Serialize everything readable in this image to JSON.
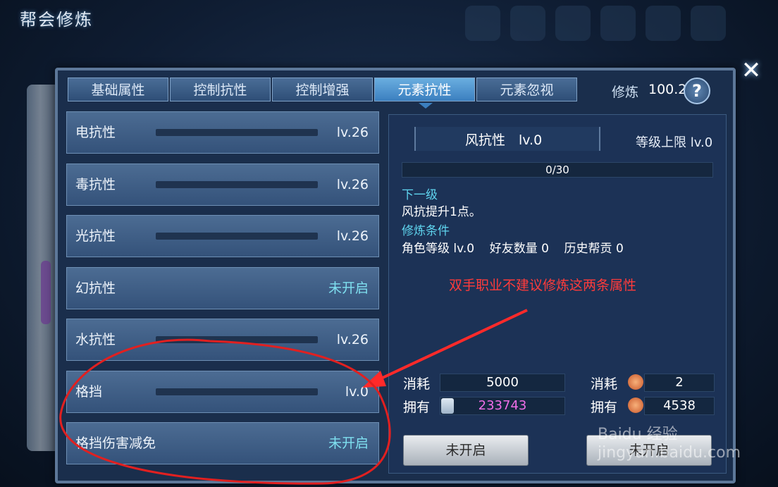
{
  "title": "帮会修炼",
  "close_icon": "close-icon",
  "tabs": [
    {
      "label": "基础属性",
      "active": false
    },
    {
      "label": "控制抗性",
      "active": false
    },
    {
      "label": "控制增强",
      "active": false
    },
    {
      "label": "元素抗性",
      "active": true
    },
    {
      "label": "元素忽视",
      "active": false
    }
  ],
  "xiulian": {
    "label": "修炼",
    "value": "100.2",
    "help": "?"
  },
  "resistances": [
    {
      "name": "电抗性",
      "level": "lv.26"
    },
    {
      "name": "毒抗性",
      "level": "lv.26"
    },
    {
      "name": "光抗性",
      "level": "lv.26"
    },
    {
      "name": "幻抗性",
      "level": "未开启"
    },
    {
      "name": "水抗性",
      "level": "lv.26"
    },
    {
      "name": "格挡",
      "level": "lv.0"
    },
    {
      "name": "格挡伤害减免",
      "level": "未开启"
    }
  ],
  "detail": {
    "name": "风抗性　lv.0",
    "max_level": "等级上限 lv.0",
    "progress_text": "0/30",
    "progress_fraction": 0,
    "next_label": "下一级",
    "next_text": "风抗提升1点。",
    "cond_label": "修炼条件",
    "cond_text": "角色等级 lv.0    好友数量 0    历史帮贡 0"
  },
  "annotation": "双手职业不建议修炼这两条属性",
  "cost": {
    "left": {
      "consume_label": "消耗",
      "consume_value": "5000",
      "own_label": "拥有",
      "own_value": "233743"
    },
    "right": {
      "consume_label": "消耗",
      "consume_value": "2",
      "own_label": "拥有",
      "own_value": "4538"
    }
  },
  "buttons": {
    "left": "未开启",
    "right": "未开启"
  },
  "watermark": "Baidu 经验 jingyan.baidu.com",
  "colors": {
    "accent_cyan": "#5fd4ee",
    "annotation_red": "#ff3b3b",
    "pink_value": "#f06ee8"
  }
}
